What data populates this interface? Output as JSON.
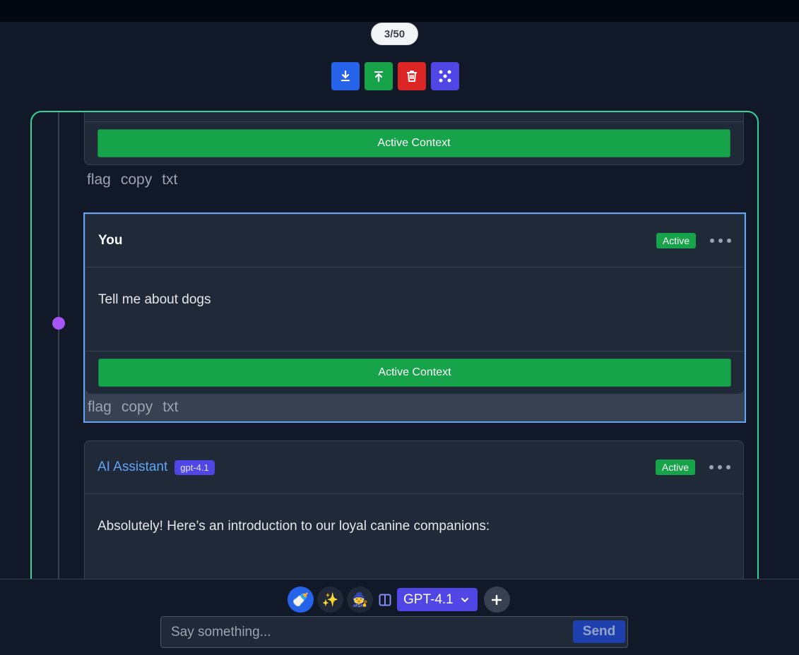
{
  "counter": "3/50",
  "toolbar": {
    "icons": [
      "download-icon",
      "upload-icon",
      "trash-icon",
      "branch-icon"
    ],
    "colors": [
      "#2563eb",
      "#16a34a",
      "#dc2626",
      "#4f46e5"
    ]
  },
  "thread": {
    "border_color": "#34d399",
    "prev": {
      "context_label": "Active Context",
      "actions": [
        "flag",
        "copy",
        "txt"
      ]
    },
    "user_message": {
      "sender": "You",
      "status": "Active",
      "body": "Tell me about dogs",
      "context_label": "Active Context",
      "actions": [
        "flag",
        "copy",
        "txt"
      ]
    },
    "ai_message": {
      "sender": "AI Assistant",
      "model": "gpt-4.1",
      "status": "Active",
      "body": "Absolutely! Here’s an introduction to our loyal canine companions:"
    }
  },
  "bottom": {
    "modes": [
      "bottle-icon",
      "sparkles-icon",
      "wizard-icon"
    ],
    "model_select": "GPT-4.1",
    "input_placeholder": "Say something...",
    "send_label": "Send"
  }
}
